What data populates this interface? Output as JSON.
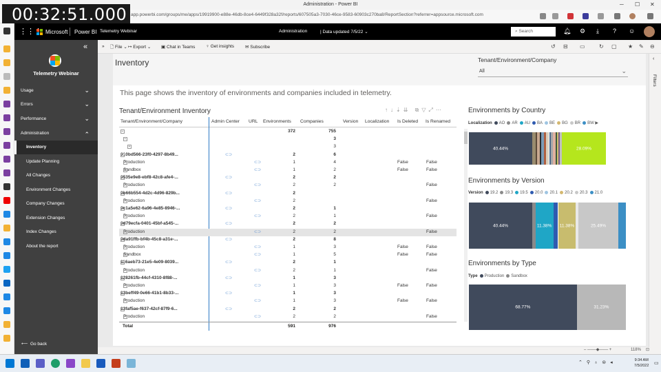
{
  "window": {
    "title": "Administration - Power BI"
  },
  "timer": "00:32:51.000",
  "browser": {
    "url": "app.powerbi.com/groups/me/apps/19919900-e88e-46db-8ce4-6449f328a32f/reports/607505a3-7030-46ce-9583-60903c270ba8/ReportSection?referrer=appsource.microsoft.com"
  },
  "appbar": {
    "microsoft": "Microsoft",
    "product": "Power BI",
    "workspace": "Telemetry Webinar",
    "section": "Administration",
    "data_updated": "Data updated 7/5/22",
    "search_placeholder": "Search"
  },
  "sidebar": {
    "brand": "Telemetry Webinar",
    "items": [
      {
        "label": "Usage"
      },
      {
        "label": "Errors"
      },
      {
        "label": "Performance"
      },
      {
        "label": "Administration"
      }
    ],
    "subitems": [
      {
        "label": "Inventory"
      },
      {
        "label": "Update Planning"
      },
      {
        "label": "All Changes"
      },
      {
        "label": "Environment Changes"
      },
      {
        "label": "Company Changes"
      },
      {
        "label": "Extension Changes"
      },
      {
        "label": "Index Changes"
      },
      {
        "label": "About the report"
      }
    ],
    "go_back": "Go back"
  },
  "toolbar": {
    "file": "File",
    "export": "Export",
    "chat": "Chat in Teams",
    "insights": "Get insights",
    "subscribe": "Subscribe"
  },
  "page": {
    "title": "Inventory",
    "description": "This page shows the inventory of environments and companies included in telemetry.",
    "slicer": {
      "label": "Tenant/Environment/Company",
      "value": "All"
    }
  },
  "table": {
    "title": "Tenant/Environment Inventory",
    "headers": {
      "name": "Tenant/Environment/Company",
      "admin": "Admin Center",
      "url": "URL",
      "env": "Environments",
      "comp": "Companies",
      "version": "Version",
      "loc": "Localization",
      "deleted": "Is Deleted",
      "renamed": "Is Renamed"
    },
    "total": {
      "label": "Total",
      "env": "591",
      "comp": "976"
    }
  },
  "chart_data": [
    {
      "type": "bar",
      "title": "Environments by Country",
      "legend_title": "Localization",
      "legend": [
        "AO",
        "AR",
        "AU",
        "BA",
        "BE",
        "BG",
        "BR",
        "BW"
      ],
      "labels": [
        "40.44%",
        "28.09%"
      ]
    },
    {
      "type": "bar",
      "title": "Environments by Version",
      "legend_title": "Version",
      "legend": [
        "19.2",
        "19.3",
        "19.5",
        "20.0",
        "20.1",
        "20.2",
        "20.3",
        "21.0"
      ],
      "labels": [
        "40.44%",
        "11.38%",
        "11.38%",
        "25.49%"
      ]
    },
    {
      "type": "bar",
      "title": "Environments by Type",
      "legend_title": "Type",
      "legend": [
        "Production",
        "Sandbox"
      ],
      "labels": [
        "68.77%",
        "31.23%"
      ]
    }
  ],
  "status": {
    "zoom": "118%"
  },
  "filters_label": "Filters",
  "clock": {
    "time": "9:34 AM",
    "date": "7/5/2022"
  }
}
